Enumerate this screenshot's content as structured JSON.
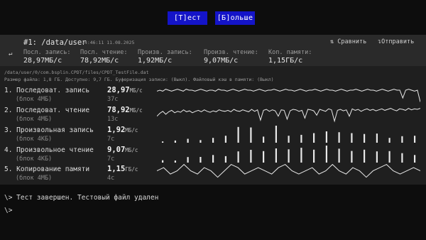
{
  "top_buttons": {
    "test_label": "[Т]ест",
    "more_label": "[Б]ольше"
  },
  "run": {
    "chevron": "↵",
    "title": "#1: /data/user",
    "timestamp": "14:46:11 11.08.2025",
    "compare_icon": "⇅",
    "compare_label": "Сравнить",
    "send_icon": "↴",
    "send_label": "Отправить",
    "summary_headers": [
      "Посл. запись:",
      "Посл. чтение:",
      "Произв. запись:",
      "Произв. чтение:",
      "Коп. памяти:"
    ],
    "summary_values": [
      "28,97МБ/с",
      "78,92МБ/с",
      "1,92МБ/с",
      "9,07МБ/с",
      "1,15ГБ/с"
    ]
  },
  "details": {
    "path": "/data/user/0/com.bsplin.CPDT/files/CPDT_TestFile.dat",
    "info": "Размер файла: 1,8 ГБ. Доступно: 9,7 ГБ. Буферизация записи: (Выкл). Файловый кэш в памяти: (Выкл)"
  },
  "results": [
    {
      "name": "1. Последоват. запись",
      "block": "(блок 4МБ)",
      "value": "28,97",
      "unit": "МБ/с",
      "temp": "37c",
      "graph": "line",
      "series": [
        29,
        30,
        29,
        31,
        30,
        29,
        30,
        31,
        30,
        29,
        31,
        30,
        30,
        29,
        30,
        31,
        30,
        29,
        30,
        30,
        29,
        31,
        30,
        30,
        29,
        30,
        31,
        30,
        29,
        30,
        31,
        30,
        30,
        29,
        30,
        31,
        30,
        29,
        30,
        30,
        31,
        30,
        29,
        30,
        31,
        30,
        30,
        29,
        30,
        31,
        30,
        29,
        30,
        30,
        31,
        30,
        29,
        30,
        31,
        30,
        30,
        29,
        30,
        31,
        30,
        29,
        30,
        30,
        31,
        30,
        29,
        30,
        31,
        30,
        30,
        29,
        30,
        31,
        30,
        29,
        30,
        31,
        30,
        30,
        22,
        30,
        31,
        30,
        29,
        30,
        18
      ]
    },
    {
      "name": "2. Последоват. чтение",
      "block": "(блок 4МБ)",
      "value": "78,92",
      "unit": "МБ/с",
      "temp": "13c",
      "graph": "line",
      "series": [
        70,
        76,
        80,
        74,
        79,
        82,
        77,
        80,
        78,
        83,
        79,
        81,
        77,
        80,
        82,
        79,
        83,
        80,
        78,
        81,
        79,
        83,
        81,
        80,
        82,
        79,
        84,
        81,
        80,
        83,
        81,
        79,
        84,
        80,
        83,
        62,
        82,
        84,
        80,
        83,
        81,
        70,
        83,
        82,
        64,
        81,
        84,
        83,
        80,
        82,
        66,
        84,
        83,
        81,
        72,
        84,
        82,
        80,
        85,
        83,
        60,
        82,
        84,
        81,
        83,
        70,
        85,
        82,
        84,
        80,
        83,
        85,
        82,
        84,
        81,
        83,
        85,
        82,
        84,
        86,
        83,
        81,
        85,
        84,
        82,
        86,
        83,
        85,
        84,
        86
      ]
    },
    {
      "name": "3. Произвольная запись",
      "block": "(блок 4КБ)",
      "value": "1,92",
      "unit": "МБ/с",
      "temp": "7c",
      "graph": "bars",
      "series": [
        0.3,
        0.5,
        0.9,
        0.6,
        1.1,
        1.6,
        3.6,
        3.5,
        1.4,
        3.9,
        1.6,
        1.8,
        2.2,
        2.6,
        2.4,
        2.2,
        2.0,
        2.1,
        1.1,
        1.5,
        1.6
      ]
    },
    {
      "name": "4. Произвольное чтение",
      "block": "(блок 4КБ)",
      "value": "9,07",
      "unit": "МБ/с",
      "temp": "7c",
      "graph": "bars",
      "series": [
        1.5,
        1.3,
        3.5,
        3.6,
        4.8,
        4.1,
        7.1,
        8.1,
        7.3,
        9.0,
        8.4,
        9.4,
        8.2,
        10.8,
        8.8,
        7.4,
        8.2,
        7.1,
        7.3,
        6.0,
        4.8
      ]
    },
    {
      "name": "5. Копирование памяти",
      "block": "(блок 4МБ)",
      "value": "1,15",
      "unit": "ГБ/с",
      "temp": "4c",
      "graph": "line",
      "series": [
        1.15,
        1.16,
        1.14,
        1.15,
        1.17,
        1.15,
        1.14,
        1.16,
        1.15,
        1.13,
        1.15,
        1.17,
        1.16,
        1.14,
        1.15,
        1.16,
        1.15,
        1.14,
        1.16,
        1.17,
        1.15,
        1.14,
        1.15,
        1.16,
        1.14,
        1.15,
        1.17,
        1.15,
        1.14,
        1.16,
        1.15,
        1.13,
        1.15,
        1.16,
        1.17,
        1.15,
        1.14,
        1.15,
        1.16,
        1.15
      ]
    }
  ],
  "console": {
    "line1": "\\> Тест завершен. Тестовый файл удален",
    "line2": "\\>"
  },
  "colors": {
    "button_bg": "#1414c8",
    "panel_bg": "#1f1f1f",
    "header_bg": "#2a2a2a",
    "graph_stroke": "#e8e8e8"
  }
}
